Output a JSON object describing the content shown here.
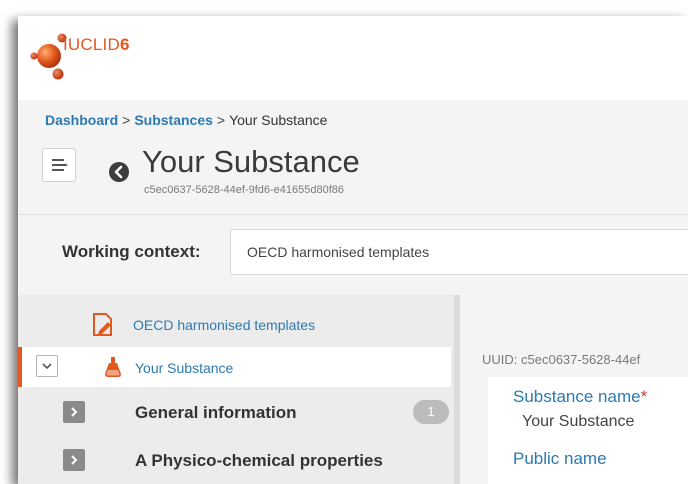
{
  "app": {
    "logo_text": "IUCLID",
    "logo_version": "6"
  },
  "breadcrumb": {
    "items": [
      "Dashboard",
      "Substances"
    ],
    "separator": ">",
    "current": "Your Substance"
  },
  "header": {
    "title": "Your Substance",
    "uuid": "c5ec0637-5628-44ef-9fd6-e41655d80f86"
  },
  "working_context": {
    "label": "Working context:",
    "value": "OECD harmonised templates"
  },
  "tree": {
    "template": {
      "label": "OECD harmonised templates",
      "icon": "template-document-icon"
    },
    "substance": {
      "label": "Your Substance",
      "icon": "flask-icon"
    },
    "sections": [
      {
        "label": "General information",
        "badge": "1"
      },
      {
        "label": "A Physico-chemical properties"
      }
    ]
  },
  "content": {
    "uuid_text": "UUID: c5ec0637-5628-44ef",
    "fields": [
      {
        "label": "Substance name",
        "required_mark": "*",
        "value": "Your Substance"
      },
      {
        "label": "Public name"
      }
    ]
  },
  "colors": {
    "accent": "#e2581e",
    "link": "#2c7ab0",
    "panel_bg": "#f4f4f4"
  }
}
